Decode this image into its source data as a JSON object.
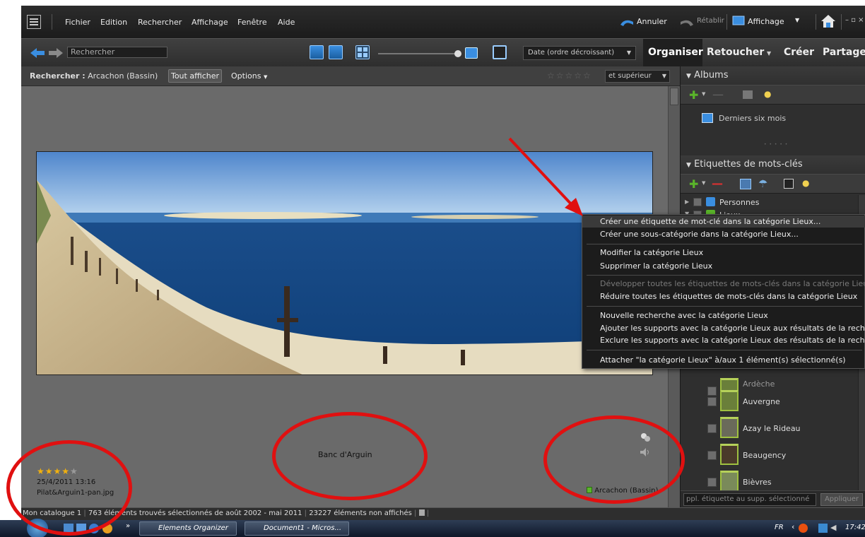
{
  "menubar": {
    "items": [
      "Fichier",
      "Edition",
      "Rechercher",
      "Affichage",
      "Fenêtre",
      "Aide"
    ],
    "undo_label": "Annuler",
    "redo_label": "Rétablir",
    "display_label": "Affichage",
    "window_controls": "– ▫ ×"
  },
  "toolbar": {
    "search_placeholder": "Rechercher",
    "sort_value": "Date (ordre décroissant)",
    "tabs": [
      "Organiser",
      "Retoucher",
      "Créer",
      "Partage"
    ]
  },
  "searchbar": {
    "label_prefix": "Rechercher :",
    "label_value": "Arcachon (Bassin)",
    "show_all": "Tout afficher",
    "options": "Options",
    "rating_filter": "et supérieur",
    "rating_stars": 0
  },
  "photo_item": {
    "caption": "Banc d'Arguin",
    "rating": 4,
    "rating_max": 5,
    "date": "25/4/2011 13:16",
    "filename": "Pilat&Arguin1-pan.jpg",
    "keyword_tag": "Arcachon (Bassin)"
  },
  "albums_panel": {
    "title": "Albums",
    "items": [
      "Derniers six mois"
    ],
    "grip": "• • • • •"
  },
  "keywords_panel": {
    "title": "Etiquettes de mots-clés",
    "categories": [
      "Personnes",
      "Lieux"
    ],
    "items": [
      "Auvergne",
      "Azay le Rideau",
      "Beaugency",
      "Bièvres"
    ],
    "partial_item": "Ardèche",
    "apply_placeholder": "ppl. étiquette au supp. sélectionné",
    "apply_button": "Appliquer"
  },
  "context_menu": {
    "items": [
      {
        "label": "Créer une étiquette de mot-clé dans la catégorie Lieux...",
        "enabled": true
      },
      {
        "label": "Créer une sous-catégorie dans la catégorie Lieux...",
        "enabled": true
      },
      {
        "label": "Modifier la catégorie Lieux",
        "enabled": true
      },
      {
        "label": "Supprimer la catégorie Lieux",
        "enabled": true
      },
      {
        "label": "Développer toutes les étiquettes de mots-clés dans la catégorie Lieux",
        "enabled": false
      },
      {
        "label": "Réduire toutes les étiquettes de mots-clés dans la catégorie Lieux",
        "enabled": true
      },
      {
        "label": "Nouvelle recherche avec la catégorie Lieux",
        "enabled": true
      },
      {
        "label": "Ajouter les supports avec la catégorie Lieux aux résultats de la recherche",
        "enabled": true
      },
      {
        "label": "Exclure les supports avec la catégorie Lieux des résultats de la recherche",
        "enabled": true
      },
      {
        "label": "Attacher \"la catégorie Lieux\" à/aux 1 élément(s) sélectionné(s)",
        "enabled": true
      }
    ]
  },
  "statusbar": {
    "catalog": "Mon catalogue 1",
    "found": "763 éléments trouvés sélectionnés de août 2002 - mai 2011",
    "hidden": "23227 éléments non affichés"
  },
  "taskbar": {
    "buttons": [
      "Elements Organizer",
      "Document1 - Micros..."
    ],
    "lang": "FR",
    "time": "17:42"
  },
  "colors": {
    "annotation": "#e01010",
    "panel_bg": "#2f2f2f",
    "grid_bg": "#6a6a6a",
    "accent_green": "#5ab52a",
    "accent_blue": "#2a8ae0"
  }
}
